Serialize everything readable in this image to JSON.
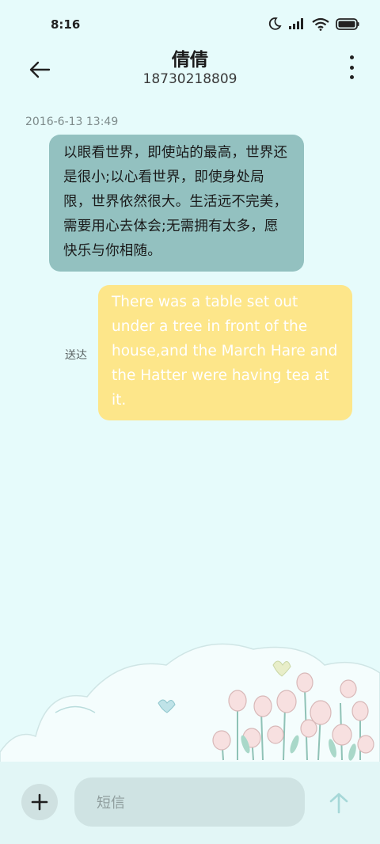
{
  "status_bar": {
    "time": "8:16"
  },
  "header": {
    "contact_name": "倩倩",
    "phone_number": "18730218809"
  },
  "conversation": {
    "timestamp": "2016-6-13 13:49",
    "messages": [
      {
        "direction": "incoming",
        "text": "以眼看世界，即使站的最高，世界还是很小;以心看世界，即使身处局限，世界依然很大。生活远不完美，需要用心去体会;无需拥有太多，愿快乐与你相随。"
      },
      {
        "direction": "outgoing",
        "text": "There was a table set out under a tree in front of the house,and the March Hare and the Hatter were having tea at it.",
        "status": "送达"
      }
    ]
  },
  "composer": {
    "placeholder": "短信"
  },
  "colors": {
    "background": "#e6fbfb",
    "incoming_bubble": "#93c1c0",
    "outgoing_bubble": "#fde68a",
    "send_arrow": "#a6d8d8"
  }
}
